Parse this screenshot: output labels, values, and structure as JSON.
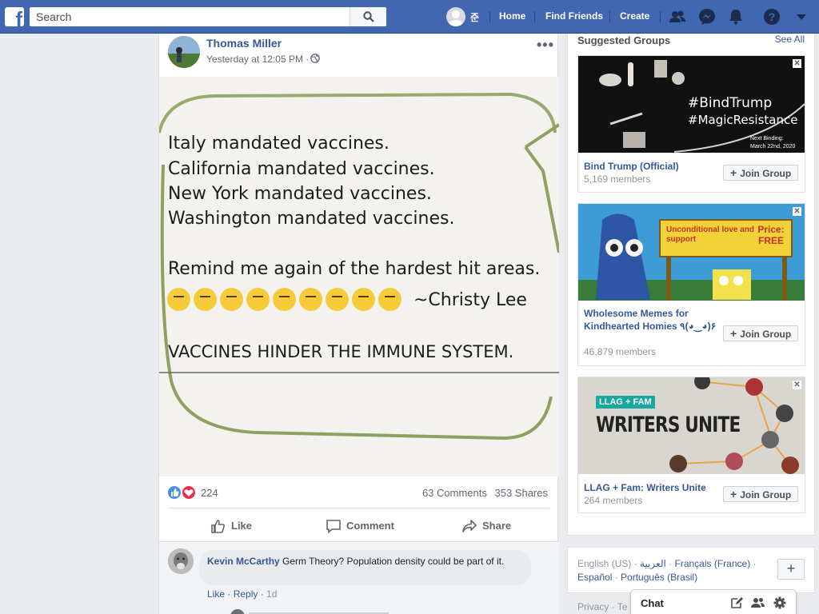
{
  "topbar": {
    "search_placeholder": "Search",
    "user_name": "준",
    "nav": [
      "Home",
      "Find Friends",
      "Create"
    ],
    "colors": {
      "bar": "#4267b2",
      "text": "#ffffff"
    }
  },
  "post": {
    "author": "Thomas Miller",
    "time": "Yesterday at 12:05 PM · ",
    "menu": "•••",
    "image_lines": [
      "Italy mandated vaccines.",
      "California mandated vaccines.",
      "New York mandated vaccines.",
      "Washington mandated vaccines.",
      "Remind me again of the hardest hit areas.",
      "~Christy Lee",
      "VACCINES HINDER THE IMMUNE SYSTEM."
    ],
    "reaction_count": "224",
    "comments_count": "63 Comments",
    "shares_count": "353 Shares",
    "actions": {
      "like": "Like",
      "comment": "Comment",
      "share": "Share"
    }
  },
  "comment": {
    "author": "Kevin McCarthy",
    "text": " Germ Theory? Population density could be part of it.",
    "like": "Like",
    "reply": "Reply",
    "time": "1d"
  },
  "sidebar": {
    "title": "Suggested Groups",
    "see_all": "See All",
    "join_label": "Join Group",
    "groups": [
      {
        "name": "Bind Trump (Official)",
        "members": "5,169 members",
        "image_text": [
          "#BindTrump",
          "#MagicResistance",
          "Next Binding:",
          "March 22nd, 2020"
        ]
      },
      {
        "name": "Wholesome Memes for Kindhearted Homies ٩(◕‿◕)۶",
        "members": "46,879 members",
        "image_text": [
          "Unconditional love and support",
          "Price: FREE"
        ]
      },
      {
        "name": "LLAG + Fam: Writers Unite",
        "members": "264 members",
        "image_text": [
          "LLAG + FAM",
          "WRITERS UNITE"
        ]
      }
    ]
  },
  "footer": {
    "lang_current": "English (US)",
    "langs": [
      "العربية",
      "Français (France)",
      "Español",
      "Português (Brasil)"
    ],
    "plus": "+",
    "privacy": "Privacy · Te"
  },
  "chat": {
    "label": "Chat"
  }
}
